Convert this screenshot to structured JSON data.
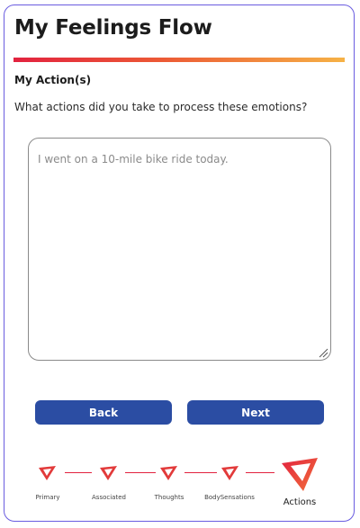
{
  "header": {
    "title": "My Feelings Flow"
  },
  "section": {
    "heading": "My Action(s)",
    "question": "What actions did you take to process these emotions?"
  },
  "answer": {
    "value": "",
    "placeholder": "I went on a 10-mile bike ride today."
  },
  "buttons": {
    "back_label": "Back",
    "next_label": "Next"
  },
  "progress": {
    "steps": [
      {
        "label": "Primary",
        "current": false
      },
      {
        "label": "Associated",
        "current": false
      },
      {
        "label": "Thoughts",
        "current": false
      },
      {
        "label": "BodySensations",
        "current": false
      },
      {
        "label": "Actions",
        "current": true
      }
    ],
    "step_icon": "triangle-arrow-icon"
  },
  "colors": {
    "border": "#6a5ce0",
    "gradient_start": "#e2223f",
    "gradient_end": "#f6b246",
    "button": "#2b4da3"
  }
}
